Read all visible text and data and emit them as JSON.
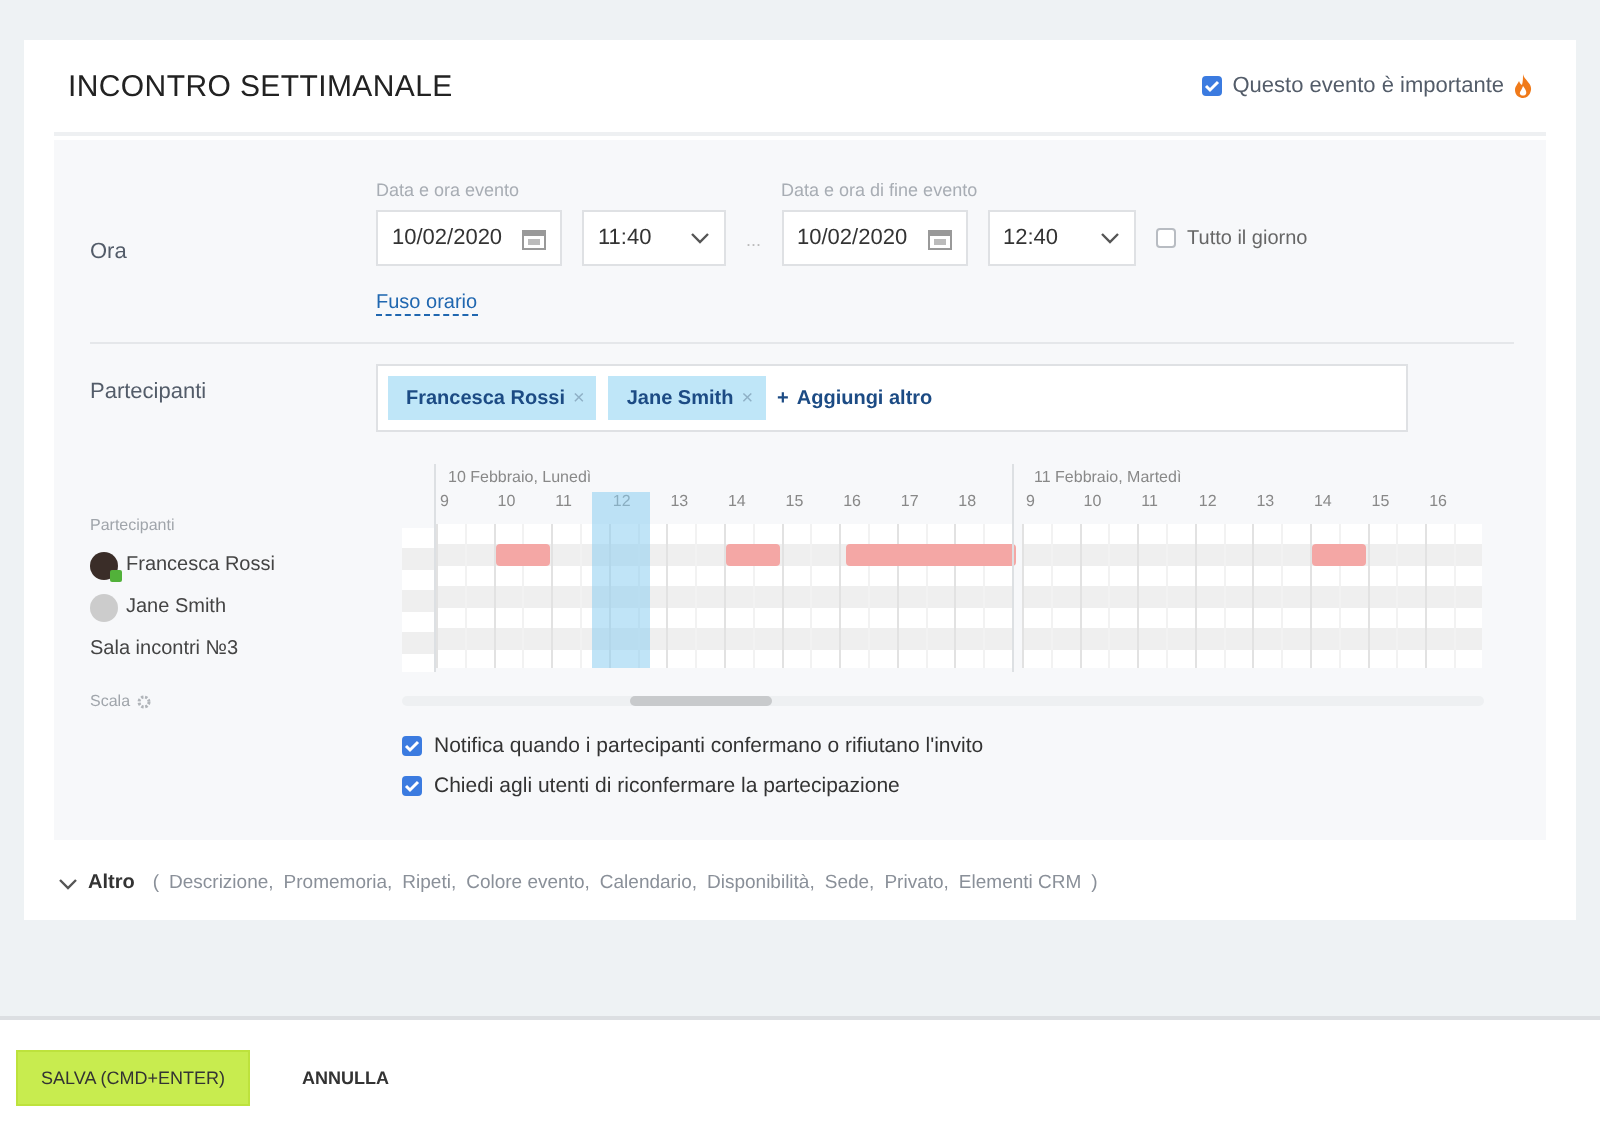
{
  "title": "INCONTRO SETTIMANALE",
  "important": {
    "label": "Questo evento è importante",
    "checked": true
  },
  "time": {
    "label": "Ora",
    "start_caption": "Data e ora evento",
    "end_caption": "Data e ora di fine evento",
    "start_date": "10/02/2020",
    "start_time": "11:40",
    "separator": "...",
    "end_date": "10/02/2020",
    "end_time": "12:40",
    "all_day": {
      "label": "Tutto il giorno",
      "checked": false
    },
    "timezone_link": "Fuso orario"
  },
  "participants": {
    "label": "Partecipanti",
    "tags": [
      "Francesca Rossi",
      "Jane Smith"
    ],
    "remove_glyph": "×",
    "add_glyph": "+",
    "add_link": "Aggiungi altro"
  },
  "planner": {
    "heading": "Partecipanti",
    "scale_label": "Scala",
    "days": [
      {
        "title": "10 Febbraio, Lunedì",
        "hours": [
          "9",
          "10",
          "11",
          "12",
          "13",
          "14",
          "15",
          "16",
          "17",
          "18"
        ]
      },
      {
        "title": "11 Febbraio, Martedì",
        "hours": [
          "9",
          "10",
          "11",
          "12",
          "13",
          "14",
          "15",
          "16"
        ]
      }
    ],
    "rows": [
      {
        "name": "Francesca Rossi",
        "kind": "person",
        "online": true
      },
      {
        "name": "Jane Smith",
        "kind": "person",
        "online": false
      },
      {
        "name": "Sala incontri №3",
        "kind": "room"
      }
    ]
  },
  "options": [
    {
      "label": "Notifica quando i partecipanti confermano o rifiutano l'invito",
      "checked": true
    },
    {
      "label": "Chiedi agli utenti di riconfermare la partecipazione",
      "checked": true
    }
  ],
  "more": {
    "label": "Altro",
    "open_paren": "(",
    "items": [
      "Descrizione,",
      "Promemoria,",
      "Ripeti,",
      "Colore evento,",
      "Calendario,",
      "Disponibilità,",
      "Sede,",
      "Privato,",
      "Elementi CRM"
    ],
    "close_paren": ")"
  },
  "buttons": {
    "save": "SALVA (CMD+ENTER)",
    "cancel": "ANNULLA"
  }
}
